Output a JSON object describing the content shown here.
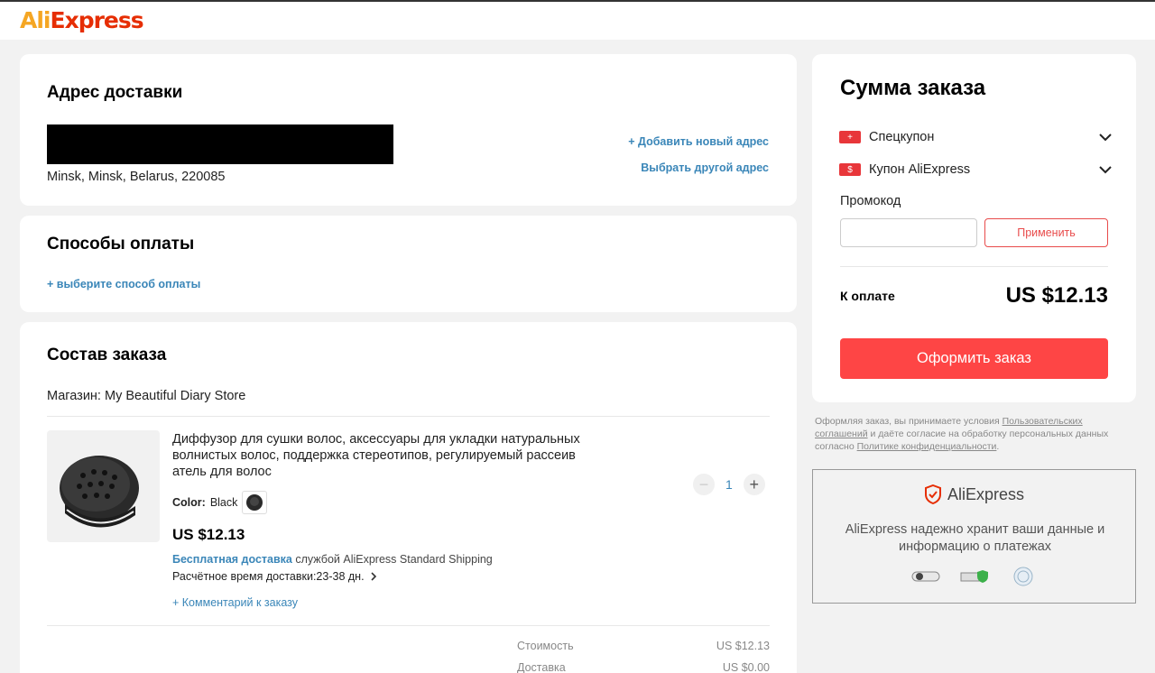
{
  "header": {
    "logo_part1": "Ali",
    "logo_part2": "Express"
  },
  "address": {
    "title": "Адрес доставки",
    "location": "Minsk, Minsk, Belarus, 220085",
    "add_new": "+ Добавить новый адрес",
    "choose_other": "Выбрать другой адрес"
  },
  "payment": {
    "title": "Способы оплаты",
    "choose": "+ выберите способ оплаты"
  },
  "order": {
    "title": "Состав заказа",
    "store": "Магазин: My Beautiful Diary Store",
    "item": {
      "title": "Диффузор для сушки волос, аксессуары для укладки натуральных волнистых волос, поддержка стереотипов, регулируемый рассеив атель для волос",
      "color_label": "Color:",
      "color_value": "Black",
      "price": "US $12.13",
      "free_shipping": "Бесплатная доставка",
      "shipping_service": "службой AliExpress Standard Shipping",
      "eta": "Расчётное время доставки:23-38 дн.",
      "comment": "+ Комментарий к заказу",
      "quantity": "1"
    },
    "totals": [
      {
        "label": "Стоимость",
        "value": "US $12.13"
      },
      {
        "label": "Доставка",
        "value": "US $0.00"
      }
    ]
  },
  "summary": {
    "title": "Сумма заказа",
    "special_coupon": "Спецкупон",
    "ae_coupon": "Купон AliExpress",
    "promo_label": "Промокод",
    "promo_placeholder": "",
    "apply": "Применить",
    "to_pay_label": "К оплате",
    "total": "US $12.13",
    "checkout": "Оформить заказ"
  },
  "terms": {
    "part1": "Оформляя заказ, вы принимаете условия ",
    "link1": "Пользовательских соглашений",
    "part2": " и даёте согласие на обработку персональных данных согласно ",
    "link2": "Политике конфиденциальности",
    "part3": "."
  },
  "trust": {
    "logo": "AliExpress",
    "text": "AliExpress надежно хранит ваши данные и информацию о платежах"
  },
  "colors": {
    "accent_red": "#fe4545",
    "link_blue": "#3a86b8",
    "logo_orange": "#f5a623",
    "logo_red": "#e62e04"
  }
}
